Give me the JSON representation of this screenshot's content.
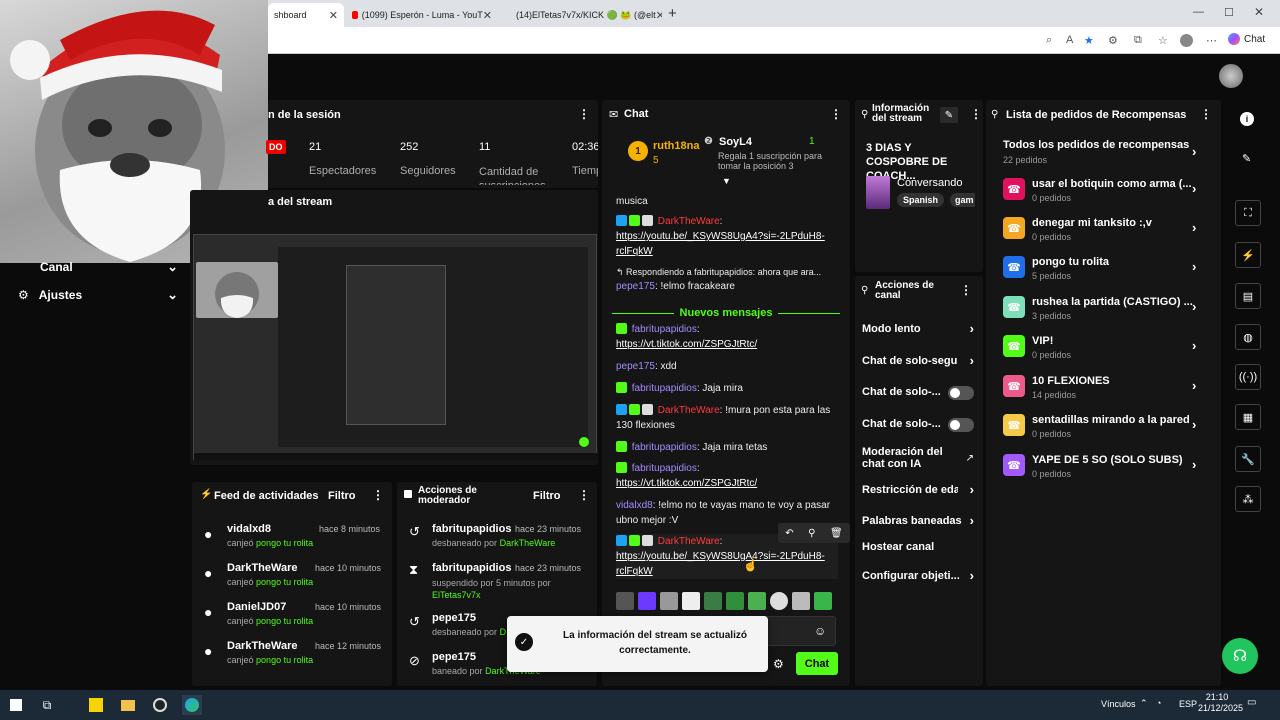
{
  "browser": {
    "tabs": [
      {
        "label": "shboard"
      },
      {
        "label": "(1099) Esperón - Luma - YouT"
      },
      {
        "label": "(14)ElTetas7v7x/KICK 🟢 🐸 (@elt"
      }
    ],
    "chat_button": "Chat"
  },
  "session": {
    "title": "n de la sesión",
    "live_badge": "DO",
    "stats": [
      {
        "value": "21",
        "label": "Espectadores"
      },
      {
        "value": "252",
        "label": "Seguidores"
      },
      {
        "value": "11",
        "label": "Cantidad de suscripciones"
      },
      {
        "value": "02:36",
        "label": "Tiemp"
      }
    ],
    "preview_title": "a del stream"
  },
  "sidebar": {
    "items": [
      {
        "label": "Canal"
      },
      {
        "label": "Ajustes"
      }
    ]
  },
  "feed": {
    "title": "Feed de actividades",
    "filter": "Filtro",
    "items": [
      {
        "user": "vidalxd8",
        "time": "hace 8 minutos",
        "action": "canjeó",
        "reward": "pongo tu rolita"
      },
      {
        "user": "DarkTheWare",
        "time": "hace 10 minutos",
        "action": "canjeó",
        "reward": "pongo tu rolita"
      },
      {
        "user": "DanielJD07",
        "time": "hace 10 minutos",
        "action": "canjeó",
        "reward": "pongo tu rolita"
      },
      {
        "user": "DarkTheWare",
        "time": "hace 12 minutos",
        "action": "canjeó",
        "reward": "pongo tu rolita"
      }
    ]
  },
  "mod": {
    "title": "Acciones de moderador",
    "filter": "Filtro",
    "items": [
      {
        "user": "fabritupapidios",
        "time": "hace 23 minutos",
        "action": "desbaneado por",
        "by": "DarkTheWare"
      },
      {
        "user": "fabritupapidios",
        "time": "hace 23 minutos",
        "action": "suspendido por 5 minutos por",
        "by": "ElTetas7v7x"
      },
      {
        "user": "pepe175",
        "time": "",
        "action": "desbaneado por",
        "by": "D"
      },
      {
        "user": "pepe175",
        "time": "",
        "action": "baneado por",
        "by": "DarkTheWare"
      }
    ]
  },
  "chat": {
    "title": "Chat",
    "leaders": [
      {
        "name": "ruth18na",
        "count": "5"
      },
      {
        "name": "SoyL4",
        "count": "1",
        "sub": "Regala 1 suscripción para tomar la posición 3"
      }
    ],
    "messages": {
      "m0": "musica",
      "m1_user": "DarkTheWare",
      "m1_text": "https://youtu.be/_KSyWS8UgA4?si=-2LPduH8-rclFqkW",
      "m2_reply": "Respondiendo a fabritupapidios: ahora que ara...",
      "m2_user": "pepe175",
      "m2_text": "!elmo fracakeare",
      "divider": "Nuevos mensajes",
      "m3_user": "fabritupapidios",
      "m3_text": "https://vt.tiktok.com/ZSPGJtRtc/",
      "m4_user": "pepe175",
      "m4_text": "xdd",
      "m5_user": "fabritupapidios",
      "m5_text": "Jaja mira",
      "m6_user": "DarkTheWare",
      "m6_text": "!mura pon esta para las 130 flexiones",
      "m7_user": "fabritupapidios",
      "m7_text": "Jaja mira tetas",
      "m8_user": "fabritupapidios",
      "m8_text": "https://vt.tiktok.com/ZSPGJtRtc/",
      "m9_user": "vidalxd8",
      "m9_text": "!elmo no te vayas mano te voy a pasar ubno mejor :V",
      "m10_user": "DarkTheWare",
      "m10_text": "https://youtu.be/_KSyWS8UgA4?si=-2LPduH8-rclFqkW"
    },
    "send": "Chat",
    "toast": "La información del stream se actualizó correctamente."
  },
  "info": {
    "title": "Información del stream",
    "stream_title": "3 DIAS Y COSPOBRE DE COACH...",
    "category": "Conversando",
    "tags": [
      "Spanish",
      "gam"
    ]
  },
  "channel": {
    "title": "Acciones de canal",
    "items": [
      {
        "label": "Modo lento",
        "kind": "arrow"
      },
      {
        "label": "Chat de solo-seguid",
        "kind": "arrow"
      },
      {
        "label": "Chat de solo-...",
        "kind": "toggle"
      },
      {
        "label": "Chat de solo-...",
        "kind": "toggle"
      },
      {
        "label": "Moderación del chat con IA",
        "kind": "external"
      },
      {
        "label": "Restricción de edad",
        "kind": "arrow"
      },
      {
        "label": "Palabras baneadas",
        "kind": "arrow"
      },
      {
        "label": "Hostear canal",
        "kind": "none"
      },
      {
        "label": "Configurar objeti...",
        "kind": "arrow"
      }
    ]
  },
  "rewards": {
    "title": "Lista de pedidos de Recompensas",
    "all_title": "Todos los pedidos de recompensas",
    "all_count": "22 pedidos",
    "items": [
      {
        "title": "usar el botiquin como arma (...",
        "count": "0 pedidos",
        "color": "#e0115f"
      },
      {
        "title": "denegar mi tanksito :,v",
        "count": "0 pedidos",
        "color": "#f5a623"
      },
      {
        "title": "pongo tu rolita",
        "count": "5 pedidos",
        "color": "#1f6feb"
      },
      {
        "title": "rushea la partida (CASTIGO) ...",
        "count": "3 pedidos",
        "color": "#7ee0b8"
      },
      {
        "title": "VIP!",
        "count": "0 pedidos",
        "color": "#53fc18"
      },
      {
        "title": "10 FLEXIONES",
        "count": "14 pedidos",
        "color": "#f05a8a"
      },
      {
        "title": "sentadillas mirando a la pared",
        "count": "0 pedidos",
        "color": "#f7c948"
      },
      {
        "title": "YAPE DE 5 SO (SOLO SUBS)",
        "count": "0 pedidos",
        "color": "#a259ff"
      }
    ]
  },
  "taskbar": {
    "network": "Vínculos",
    "lang": "ESP",
    "time": "21:10",
    "date": "21/12/2025"
  }
}
